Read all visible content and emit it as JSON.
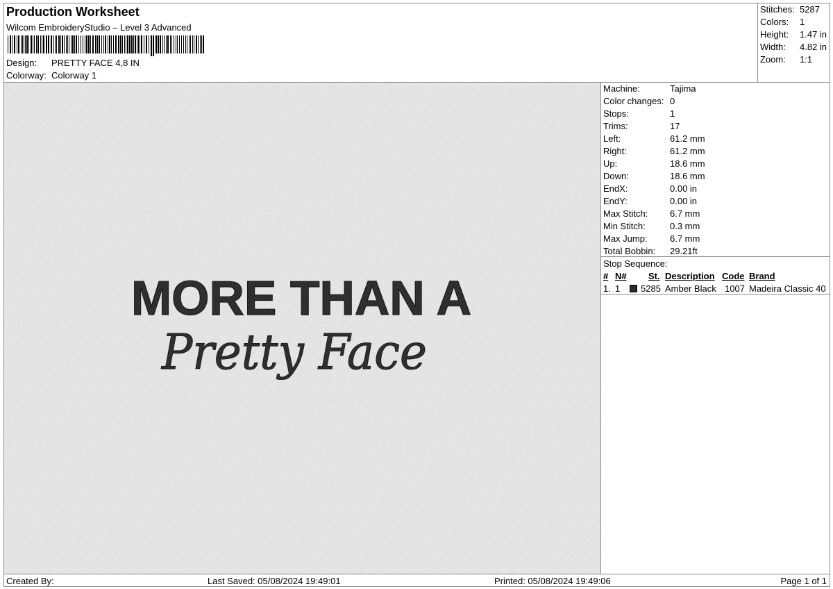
{
  "header": {
    "title": "Production Worksheet",
    "software": "Wilcom EmbroideryStudio – Level 3 Advanced",
    "design_label": "Design:",
    "design_value": "PRETTY FACE 4,8 IN",
    "colorway_label": "Colorway:",
    "colorway_value": "Colorway 1"
  },
  "summary": [
    {
      "label": "Stitches:",
      "value": "5287"
    },
    {
      "label": "Colors:",
      "value": "1"
    },
    {
      "label": "Height:",
      "value": "1.47 in"
    },
    {
      "label": "Width:",
      "value": "4.82 in"
    },
    {
      "label": "Zoom:",
      "value": "1:1"
    }
  ],
  "design": {
    "line1": "MORE THAN A",
    "line2": "Pretty Face",
    "thread_color": "#2b2b2b"
  },
  "specs": [
    {
      "label": "Machine:",
      "value": "Tajima"
    },
    {
      "label": "Color changes:",
      "value": "0"
    },
    {
      "label": "Stops:",
      "value": "1"
    },
    {
      "label": "Trims:",
      "value": "17"
    },
    {
      "label": "Left:",
      "value": "61.2 mm"
    },
    {
      "label": "Right:",
      "value": "61.2 mm"
    },
    {
      "label": "Up:",
      "value": "18.6 mm"
    },
    {
      "label": "Down:",
      "value": "18.6 mm"
    },
    {
      "label": "EndX:",
      "value": "0.00 in"
    },
    {
      "label": "EndY:",
      "value": "0.00 in"
    },
    {
      "label": "Max Stitch:",
      "value": "6.7 mm"
    },
    {
      "label": "Min Stitch:",
      "value": "0.3 mm"
    },
    {
      "label": "Max Jump:",
      "value": "6.7 mm"
    },
    {
      "label": "Total Bobbin:",
      "value": "29.21ft"
    }
  ],
  "stop_sequence": {
    "label": "Stop Sequence:",
    "headers": {
      "num": "#",
      "n": "N#",
      "st": "St.",
      "description": "Description",
      "code": "Code",
      "brand": "Brand"
    },
    "rows": [
      {
        "num": "1.",
        "n": "1",
        "color": "#2b2b2b",
        "st": "5285",
        "description": "Amber Black",
        "code": "1007",
        "brand": "Madeira Classic 40"
      }
    ]
  },
  "footer": {
    "created_by": "Created By:",
    "last_saved": "Last Saved: 05/08/2024 19:49:01",
    "printed": "Printed: 05/08/2024 19:49:06",
    "page": "Page 1 of 1"
  }
}
